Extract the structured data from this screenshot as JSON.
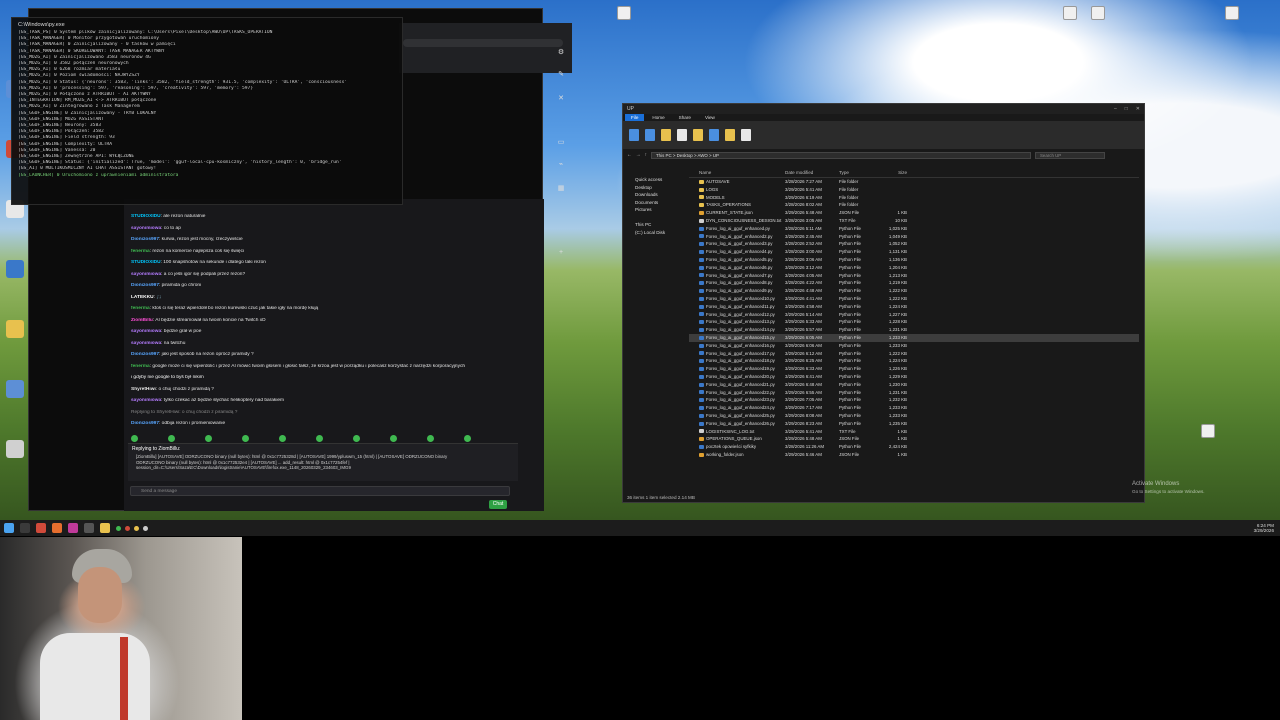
{
  "terminal": {
    "title": "C:\\Windows\\py.exe",
    "lines": [
      "[GS_TASK_PS] 0 System plików zainicjalizowany: C:\\Users\\Pixel\\Desktop\\AWO\\UP\\TASKS_OPERATION",
      "[GS_TASK_MANAGER] 0 Monitor przygotowań uruchomiony",
      "[GS_TASK_MANAGER] 0 Zainicjalizowany - 0 tasków w pamięci",
      "[GS_TASK_MANAGER] 0 SKORELOWANY: TASK MANAGER AKTYWNY",
      "[GS_MOZG_AI] 0 Zainicjalizowano 3583 neuronów 4G",
      "[GS_MOZG_AI] 0 3582 połączeń neuronowych",
      "[GS_MOZG_AI] 0 6268 rozmiar materiału",
      "[GS_MOZG_AI] 0 Poziom świadomości: NAJWYŻSZY",
      "[GS_MOZG_AI] 0 Status: {'neurons': 3583, 'links': 3582, 'field_strength': 931.5, 'complexity': 'ULTRA', 'consciousness'",
      "[GS_MOZG_AI] 0 'processing': 597, 'reasoning': 597, 'creativity': 597, 'memory': 597}",
      "[GS_MOZG_AI] 0 Połączono z ATRRIBUT - AI AKTYWNY",
      "[GS_INTEGRATION] RM_MOZG_AI <-> ATRRIBUT połączone",
      "[GS_MOZG_AI] 0 Zintegrowano z Task Managerem",
      "[GS_GGUF_ENGINE] 0 Zainicjalizowany - TRYB LOKALNY",
      "[GS_GGUF_ENGINE]    MOZG ASSISTANT",
      "[GS_GGUF_ENGINE]    Neurony: 3583",
      "[GS_GGUF_ENGINE]    Połączeń: 3582",
      "[GS_GGUF_ENGINE]    Field strength: 93",
      "[GS_GGUF_ENGINE]    Complexity: ULTRA",
      "[GS_GGUF_ENGINE]    Vanessa: 20",
      "[GS_GGUF_ENGINE]    Zewnętrzne API: WYŁĄCZONE",
      "[GS_GGUF_ENGINE] Status: {'initialized': True, 'model': 'gguf-local-cpu-kosmiczny', 'history_length': 0, 'bridge_run'",
      "[GS_AI] 0 MULTIKOSMICZNY AI CHAT ASSISTANT gotowy!",
      "[GS_LAUNCHER] 0 Uruchomiono z uprawnieniami administratora"
    ]
  },
  "chat": {
    "messages": [
      {
        "user": "STUDIOXIDU",
        "text": "ale rezon naturalnie",
        "color": "#00c8ff"
      },
      {
        "user": "sayonimiowa",
        "text": "co to ap",
        "color": "#b57cff"
      },
      {
        "user": "Dionizos997",
        "text": "kurwa, rezon jest mocny, rzeczywiście",
        "color": "#58a6ff"
      },
      {
        "user": "fenerma",
        "text": "rezon na komercie najlepsza coś się święci",
        "color": "#3fb950"
      },
      {
        "user": "STUDIOXIDU",
        "text": "100 snapshotów na sekunde i dlatego taki rezon",
        "color": "#00c8ff"
      },
      {
        "user": "sayonimiowa",
        "text": "a co jeśli igor się podpali przez rezon?",
        "color": "#b57cff"
      },
      {
        "user": "Dionizos997",
        "text": "piramida go chroni",
        "color": "#58a6ff"
      },
      {
        "user": "LATEKKU",
        "text": "🎵",
        "color": "#ffffff"
      },
      {
        "user": "fenerma",
        "text": "ktoś ci się teraz wpierdolił bo rezon kurewski czuć jak takie igły na mordę kłują",
        "color": "#3fb950"
      },
      {
        "user": "ZiomBillu",
        "text": "AI będzie streamował na twoim koncie na Twitch xD",
        "color": "#ff4fd8"
      },
      {
        "user": "sayonimiowa",
        "text": "będzie grał w poe",
        "color": "#b57cff"
      },
      {
        "user": "sayonimiowa",
        "text": "na twitchu",
        "color": "#b57cff"
      },
      {
        "user": "Dionizos997",
        "text": "jaki jest sposób na rezon oprócz piramidy ?",
        "color": "#58a6ff"
      },
      {
        "user": "fenerma",
        "text": "google może ci się wpierdolić i przez AI mówić twoim głosem i głosić fałsz, że krzoa jest w porządku i polecasz korzystać z narzędzi korporacyjnych",
        "color": "#3fb950"
      },
      {
        "user": "",
        "text": "i gdyby nie google to byś był nikim",
        "color": "#ffffff"
      },
      {
        "user": "ShyretHiwi",
        "text": "o chuj chodzi z piramidą ?",
        "color": "#e6e6e6"
      },
      {
        "user": "sayonimiowa",
        "text": "tylko czekać aż będzie słychać helikoptery nad barakiem",
        "color": "#b57cff"
      },
      {
        "user": "",
        "text": "Replying to ShyretHiwi: o chuj chodzi z piramidą ?",
        "color": "#888888"
      },
      {
        "user": "Dionizos997",
        "text": "odbija rezon i promieniowanie",
        "color": "#58a6ff"
      }
    ],
    "followers_only": "Followers-only",
    "reply_header": "Replying to ZiomBillu:",
    "reply_body": [
      "[ZiomBillu] [AUTOSAVE] ODRZUCONO binary (null bytes): html @ 0x1c7725328d | [AUTOSAVE] 1999/ypluswm_15 (html) | [AUTOSAVE] ODRZUCONO binary",
      "ODRZUCONO binary (null bytes): html @ 0x1c772532e4 | [AUTOSAVE] ... add_result: html @ 0x1c77254fef |",
      "session_dir=C:\\Users\\Saza\\EC\\Downloads\\logistranie\\AUTOSAVE\\firefox.exe_1148_20260329_234603_IMG9"
    ],
    "input_placeholder": "Send a message",
    "send_label": "Chat",
    "emote_count": 10
  },
  "explorer": {
    "title": "UP",
    "tabs": [
      "File",
      "Home",
      "Share",
      "View"
    ],
    "address": "This PC  >  Desktop  >  AWO  >  UP",
    "search_placeholder": "Search UP",
    "nav": [
      "Quick access",
      "Desktop",
      "Downloads",
      "Documents",
      "Pictures",
      "",
      "This PC",
      "(C:) Local Disk"
    ],
    "columns": [
      "Name",
      "Date modified",
      "Type",
      "Size"
    ],
    "files": [
      {
        "name": "AUTOSAVE",
        "date": "3/28/2026 7:27 AM",
        "type": "File folder",
        "size": "",
        "icon": "folder"
      },
      {
        "name": "LOGS",
        "date": "3/29/2026 5:41 AM",
        "type": "File folder",
        "size": "",
        "icon": "folder"
      },
      {
        "name": "MODELS",
        "date": "3/29/2026 6:19 AM",
        "type": "File folder",
        "size": "",
        "icon": "folder"
      },
      {
        "name": "TASKS_OPERATIONS",
        "date": "3/28/2026 8:02 AM",
        "type": "File folder",
        "size": "",
        "icon": "folder"
      },
      {
        "name": "CURRENT_STATE.json",
        "date": "3/29/2026 5:48 AM",
        "type": "JSON File",
        "size": "1 KB",
        "icon": "json"
      },
      {
        "name": "DYN_CONSCIOUSNESS_DESIGN.txt",
        "date": "3/28/2026 3:05 AM",
        "type": "TXT File",
        "size": "10 KB",
        "icon": "txt"
      },
      {
        "name": "Forex_log_ai_gguf_enhanced.py",
        "date": "3/28/2026 5:11 AM",
        "type": "Python File",
        "size": "1,025 KB",
        "icon": "py"
      },
      {
        "name": "Forex_log_ai_gguf_enhanced2.py",
        "date": "3/28/2026 2:45 AM",
        "type": "Python File",
        "size": "1,049 KB",
        "icon": "py"
      },
      {
        "name": "Forex_log_ai_gguf_enhanced3.py",
        "date": "3/28/2026 2:52 AM",
        "type": "Python File",
        "size": "1,052 KB",
        "icon": "py"
      },
      {
        "name": "Forex_log_ai_gguf_enhanced4.py",
        "date": "3/28/2026 3:00 AM",
        "type": "Python File",
        "size": "1,131 KB",
        "icon": "py"
      },
      {
        "name": "Forex_log_ai_gguf_enhanced5.py",
        "date": "3/28/2026 3:06 AM",
        "type": "Python File",
        "size": "1,136 KB",
        "icon": "py"
      },
      {
        "name": "Forex_log_ai_gguf_enhanced6.py",
        "date": "3/28/2026 3:12 AM",
        "type": "Python File",
        "size": "1,204 KB",
        "icon": "py"
      },
      {
        "name": "Forex_log_ai_gguf_enhanced7.py",
        "date": "3/28/2026 4:05 AM",
        "type": "Python File",
        "size": "1,213 KB",
        "icon": "py"
      },
      {
        "name": "Forex_log_ai_gguf_enhanced8.py",
        "date": "3/28/2026 4:22 AM",
        "type": "Python File",
        "size": "1,219 KB",
        "icon": "py"
      },
      {
        "name": "Forex_log_ai_gguf_enhanced9.py",
        "date": "3/28/2026 4:48 AM",
        "type": "Python File",
        "size": "1,222 KB",
        "icon": "py"
      },
      {
        "name": "Forex_log_ai_gguf_enhanced10.py",
        "date": "3/29/2026 4:41 AM",
        "type": "Python File",
        "size": "1,222 KB",
        "icon": "py"
      },
      {
        "name": "Forex_log_ai_gguf_enhanced11.py",
        "date": "3/29/2026 4:58 AM",
        "type": "Python File",
        "size": "1,224 KB",
        "icon": "py"
      },
      {
        "name": "Forex_log_ai_gguf_enhanced12.py",
        "date": "3/29/2026 5:14 AM",
        "type": "Python File",
        "size": "1,227 KB",
        "icon": "py"
      },
      {
        "name": "Forex_log_ai_gguf_enhanced13.py",
        "date": "3/29/2026 5:33 AM",
        "type": "Python File",
        "size": "1,228 KB",
        "icon": "py"
      },
      {
        "name": "Forex_log_ai_gguf_enhanced14.py",
        "date": "3/29/2026 5:57 AM",
        "type": "Python File",
        "size": "1,231 KB",
        "icon": "py"
      },
      {
        "name": "Forex_log_ai_gguf_enhanced15.py",
        "date": "3/29/2026 6:05 AM",
        "type": "Python File",
        "size": "1,233 KB",
        "icon": "py",
        "selected": true
      },
      {
        "name": "Forex_log_ai_gguf_enhanced16.py",
        "date": "3/29/2026 6:06 AM",
        "type": "Python File",
        "size": "1,233 KB",
        "icon": "py"
      },
      {
        "name": "Forex_log_ai_gguf_enhanced17.py",
        "date": "3/29/2026 6:12 AM",
        "type": "Python File",
        "size": "1,222 KB",
        "icon": "py"
      },
      {
        "name": "Forex_log_ai_gguf_enhanced18.py",
        "date": "3/29/2026 6:25 AM",
        "type": "Python File",
        "size": "1,224 KB",
        "icon": "py"
      },
      {
        "name": "Forex_log_ai_gguf_enhanced19.py",
        "date": "3/29/2026 6:33 AM",
        "type": "Python File",
        "size": "1,226 KB",
        "icon": "py"
      },
      {
        "name": "Forex_log_ai_gguf_enhanced20.py",
        "date": "3/29/2026 6:41 AM",
        "type": "Python File",
        "size": "1,229 KB",
        "icon": "py"
      },
      {
        "name": "Forex_log_ai_gguf_enhanced21.py",
        "date": "3/29/2026 6:48 AM",
        "type": "Python File",
        "size": "1,230 KB",
        "icon": "py"
      },
      {
        "name": "Forex_log_ai_gguf_enhanced22.py",
        "date": "3/29/2026 6:55 AM",
        "type": "Python File",
        "size": "1,231 KB",
        "icon": "py"
      },
      {
        "name": "Forex_log_ai_gguf_enhanced23.py",
        "date": "3/29/2026 7:05 AM",
        "type": "Python File",
        "size": "1,232 KB",
        "icon": "py"
      },
      {
        "name": "Forex_log_ai_gguf_enhanced24.py",
        "date": "3/29/2026 7:17 AM",
        "type": "Python File",
        "size": "1,233 KB",
        "icon": "py"
      },
      {
        "name": "Forex_log_ai_gguf_enhanced25.py",
        "date": "3/29/2026 8:08 AM",
        "type": "Python File",
        "size": "1,233 KB",
        "icon": "py"
      },
      {
        "name": "Forex_log_ai_gguf_enhanced26.py",
        "date": "3/29/2026 8:23 AM",
        "type": "Python File",
        "size": "1,235 KB",
        "icon": "py"
      },
      {
        "name": "LOGISTIKSINC_LOG.txt",
        "date": "3/29/2026 5:41 AM",
        "type": "TXT File",
        "size": "1 KB",
        "icon": "txt"
      },
      {
        "name": "OPERATIONS_QUEUE.json",
        "date": "3/29/2026 5:48 AM",
        "type": "JSON File",
        "size": "1 KB",
        "icon": "json"
      },
      {
        "name": "pocztek opowieści syfkiky",
        "date": "3/28/2026 11:26 AM",
        "type": "Python File",
        "size": "2,424 KB",
        "icon": "py"
      },
      {
        "name": "working_folder.json",
        "date": "3/29/2026 5:46 AM",
        "type": "JSON File",
        "size": "1 KB",
        "icon": "json"
      }
    ],
    "status": "36 items   1 item selected  2.14 MB"
  },
  "activate": {
    "line1": "Activate Windows",
    "line2": "Go to Settings to activate Windows."
  },
  "taskbar": {
    "time": "6:24 PM",
    "date": "3/29/2026"
  },
  "colors": {
    "accent": "#1a6fd8",
    "chat_green": "#3fb950"
  }
}
